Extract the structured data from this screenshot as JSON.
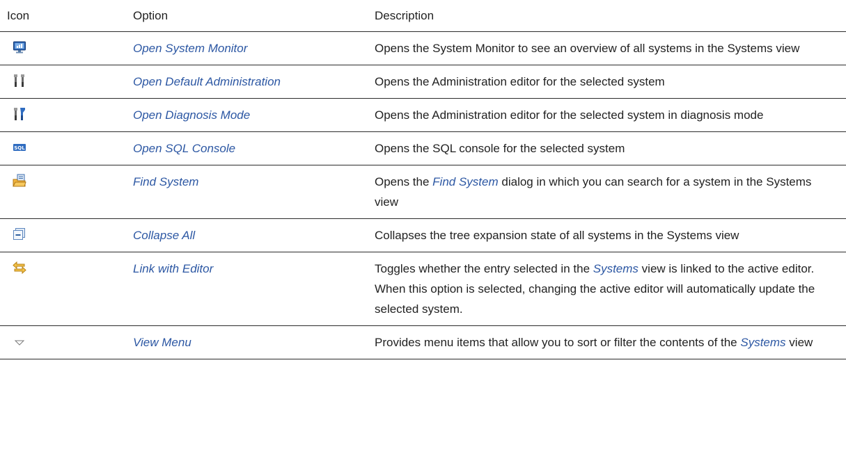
{
  "columns": {
    "icon": "Icon",
    "option": "Option",
    "description": "Description"
  },
  "rows": [
    {
      "icon": "system-monitor-icon",
      "option": "Open System Monitor",
      "description": {
        "before": "Opens the System Monitor to see an overview of all systems in the Systems view",
        "link": "",
        "after": ""
      }
    },
    {
      "icon": "default-administration-icon",
      "option": "Open Default Administration",
      "description": {
        "before": "Opens the Administration editor for the selected system",
        "link": "",
        "after": ""
      }
    },
    {
      "icon": "diagnosis-mode-icon",
      "option": "Open Diagnosis Mode",
      "description": {
        "before": "Opens the Administration editor for the selected system in diagnosis mode",
        "link": "",
        "after": ""
      }
    },
    {
      "icon": "sql-console-icon",
      "option": "Open SQL Console",
      "icon_text": "SQL",
      "description": {
        "before": "Opens the SQL console for the selected system",
        "link": "",
        "after": ""
      }
    },
    {
      "icon": "find-system-icon",
      "option": "Find System",
      "description": {
        "before": "Opens the ",
        "link": "Find System",
        "after": " dialog in which you can search for a system in the Systems view"
      }
    },
    {
      "icon": "collapse-all-icon",
      "option": "Collapse All",
      "description": {
        "before": "Collapses the tree expansion state of all systems in the Systems view",
        "link": "",
        "after": ""
      }
    },
    {
      "icon": "link-with-editor-icon",
      "option": "Link with Editor",
      "description": {
        "before": "Toggles whether the entry selected in the ",
        "link": "Systems",
        "after": " view is linked to the active editor. When this option is selected, changing the active editor will automatically update the selected system."
      }
    },
    {
      "icon": "view-menu-icon",
      "option": "View Menu",
      "description": {
        "before": "Provides menu items that allow you to sort or filter the contents of the ",
        "link": "Systems",
        "after": " view"
      }
    }
  ],
  "colors": {
    "option_link": "#2c57a3",
    "rule": "#2b2b2b"
  }
}
